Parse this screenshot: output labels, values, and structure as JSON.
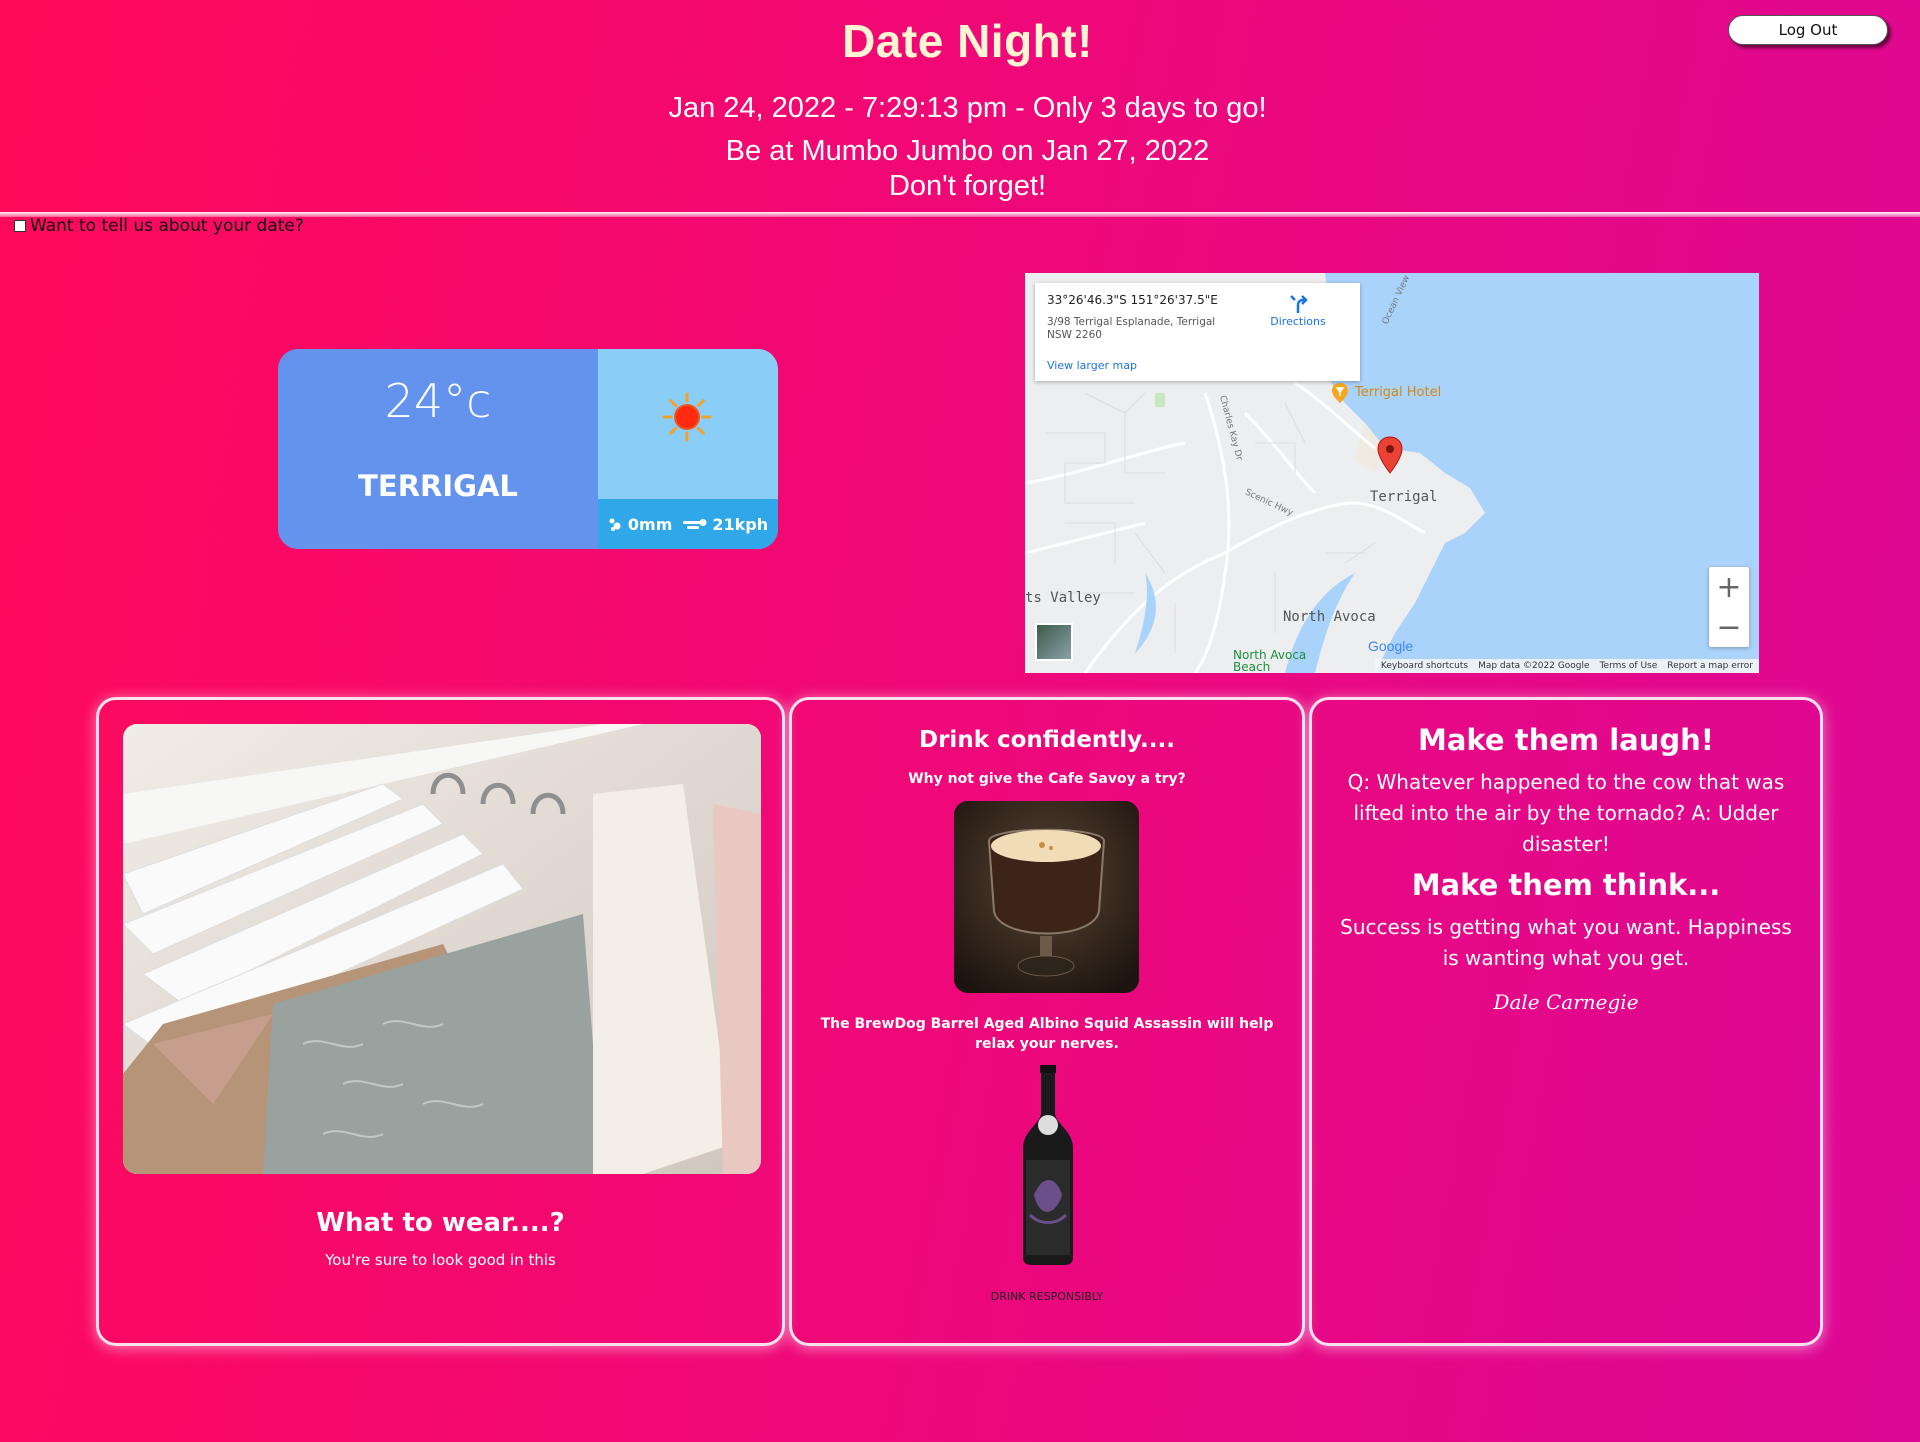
{
  "header": {
    "title": "Date Night!",
    "datetime_line": "Jan 24, 2022 - 7:29:13 pm - Only 3 days to go!",
    "location_line": "Be at Mumbo Jumbo on Jan 27, 2022",
    "reminder": "Don't forget!",
    "logout_label": "Log Out"
  },
  "feedback": {
    "checkbox_label": "Want to tell us about your date?"
  },
  "weather": {
    "temperature": "24°c",
    "city": "TERRIGAL",
    "rain": "0mm",
    "wind": "21kph",
    "icon": "sun-icon",
    "colors": {
      "left": "#6493ee",
      "right": "#8acdf6",
      "footer": "#2fa7e8"
    }
  },
  "map": {
    "coordinates": "33°26'46.3\"S 151°26'37.5\"E",
    "address": "3/98 Terrigal Esplanade, Terrigal NSW 2260",
    "directions_label": "Directions",
    "larger_map_label": "View larger map",
    "zoom_in": "+",
    "zoom_out": "−",
    "place_labels": {
      "terrigal": "Terrigal",
      "terrigal_hotel": "Terrigal Hotel",
      "north_avoca": "North Avoca",
      "north_avoca_beach": "North Avoca Beach",
      "valley": "ts Valley"
    },
    "road_labels": {
      "scenic_hwy": "Scenic Hwy",
      "charles_kay": "Charles Kay Dr",
      "ocean_view": "Ocean View"
    },
    "google_logo": "Google",
    "footer": {
      "shortcuts": "Keyboard shortcuts",
      "map_data": "Map data ©2022 Google",
      "terms": "Terms of Use",
      "report": "Report a map error"
    }
  },
  "cards": {
    "wear": {
      "title": "What to wear....?",
      "subtitle": "You're sure to look good in this"
    },
    "drink": {
      "title": "Drink confidently....",
      "subtitle": "Why not give the Cafe Savoy a try?",
      "beer_text": "The BrewDog Barrel Aged Albino Squid Assassin will help relax your nerves.",
      "disclaimer": "DRINK RESPONSIBLY"
    },
    "laugh": {
      "title": "Make them laugh!",
      "joke": "Q: Whatever happened to the cow that was lifted into the air by the tornado? A: Udder disaster!",
      "think_title": "Make them think...",
      "quote": "Success is getting what you want. Happiness is wanting what you get.",
      "author": "Dale Carnegie"
    }
  }
}
